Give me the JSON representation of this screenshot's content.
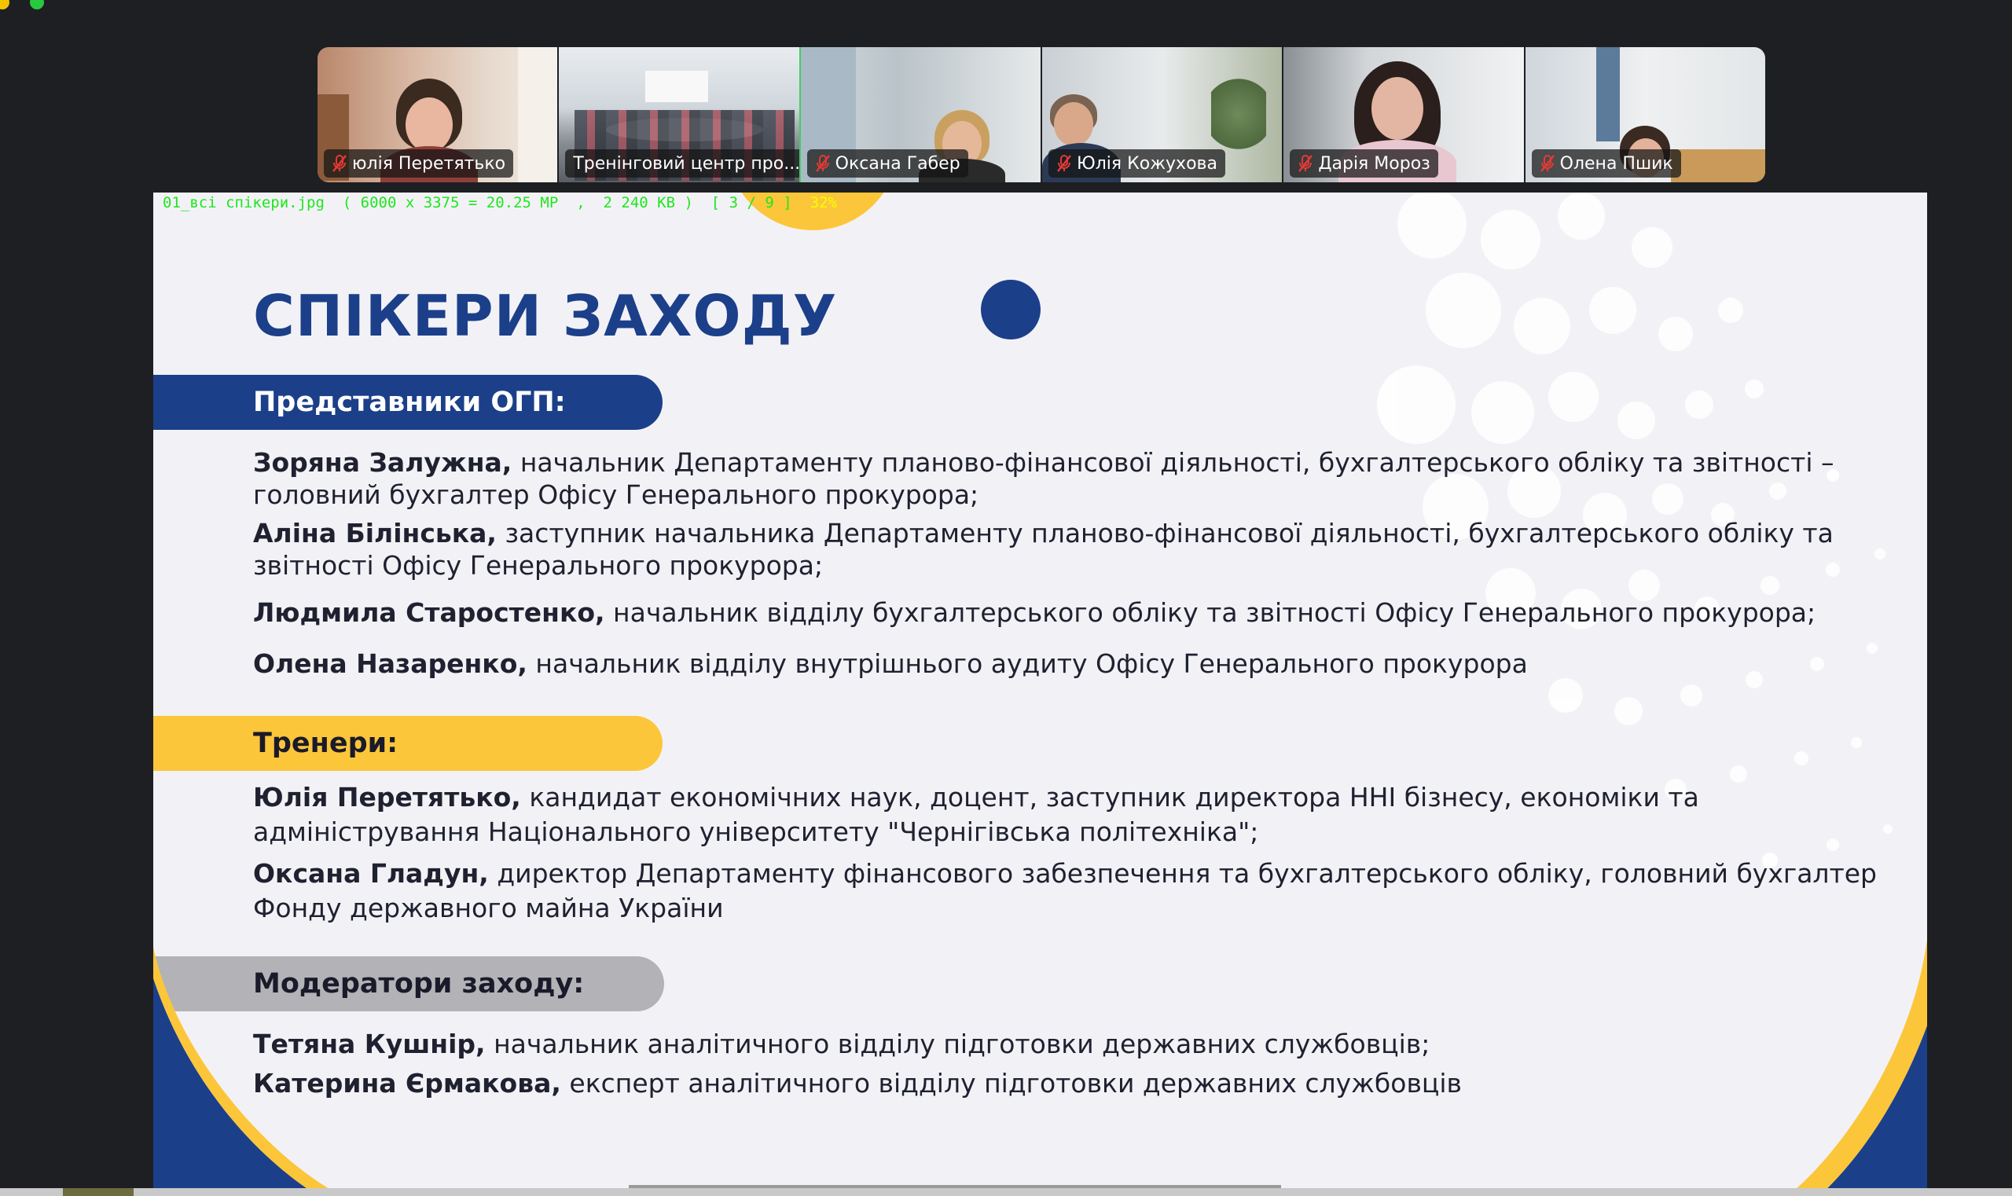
{
  "participants": [
    {
      "name": "юлія Перетятько",
      "muted": true,
      "active": false
    },
    {
      "name": "Тренінговий центр про...",
      "muted": false,
      "active": true
    },
    {
      "name": "Оксана Габер",
      "muted": true,
      "active": false
    },
    {
      "name": "Юлія Кожухова",
      "muted": true,
      "active": false
    },
    {
      "name": "Дарія Мороз",
      "muted": true,
      "active": false
    },
    {
      "name": "Олена Пшик",
      "muted": true,
      "active": false
    }
  ],
  "viewer": {
    "info": "01_всі спікери.jpg  ( 6000 x 3375 = 20.25 MP  ,  2 240 KB )  [ 3 / 9 ]",
    "zoom": "32%"
  },
  "slide": {
    "title": "СПІКЕРИ ЗАХОДУ",
    "sections": {
      "ogp": {
        "heading": "Представники ОГП:",
        "people": [
          {
            "name": "Зоряна Залужна,",
            "role": "начальник Департаменту планово-фінансової діяльності, бухгалтерського обліку та звітності – головний бухгалтер Офісу Генерального прокурора;"
          },
          {
            "name": "Аліна Білінська,",
            "role": "заступник начальника Департаменту планово-фінансової діяльності, бухгалтерського обліку та звітності Офісу Генерального прокурора;"
          },
          {
            "name": "Людмила Старостенко,",
            "role": "начальник відділу бухгалтерського обліку та звітності Офісу Генерального прокурора;"
          },
          {
            "name": "Олена Назаренко,",
            "role": "начальник відділу внутрішнього аудиту Офісу Генерального прокурора"
          }
        ]
      },
      "trainers": {
        "heading": "Тренери:",
        "people": [
          {
            "name": "Юлія Перетятько,",
            "role": "кандидат економічних наук, доцент, заступник директора ННІ бізнесу, економіки та адміністрування Національного університету \"Чернігівська політехніка\";"
          },
          {
            "name": "Оксана Гладун,",
            "role": "директор Департаменту фінансового забезпечення та бухгалтерського обліку, головний бухгалтер Фонду державного майна України"
          }
        ]
      },
      "moderators": {
        "heading": "Модератори заходу:",
        "people": [
          {
            "name": "Тетяна Кушнір,",
            "role": "начальник аналітичного відділу підготовки державних службовців;"
          },
          {
            "name": "Катерина Єрмакова,",
            "role": "експерт аналітичного відділу підготовки державних службовців"
          }
        ]
      }
    }
  },
  "colors": {
    "brand_blue": "#1c3f8a",
    "brand_yellow": "#fcc63a",
    "moderator_gray": "#b3b3b7",
    "active_speaker": "#3fd15c",
    "muted_red": "#e53935"
  }
}
